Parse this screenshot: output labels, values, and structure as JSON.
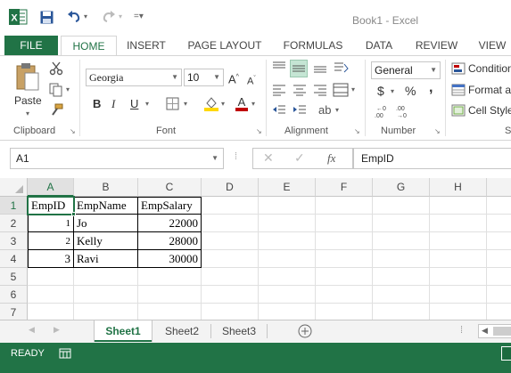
{
  "window": {
    "title": "Book1 - Excel"
  },
  "ribbon_tabs": [
    "FILE",
    "HOME",
    "INSERT",
    "PAGE LAYOUT",
    "FORMULAS",
    "DATA",
    "REVIEW",
    "VIEW"
  ],
  "ribbon": {
    "clipboard": {
      "paste_label": "Paste",
      "group_label": "Clipboard"
    },
    "font": {
      "name": "Georgia",
      "size": "10",
      "group_label": "Font",
      "bold": "B",
      "italic": "I",
      "underline": "U",
      "font_color": "#c00000",
      "fill_color": "#ffd800"
    },
    "alignment": {
      "group_label": "Alignment"
    },
    "number": {
      "format": "General",
      "currency": "$",
      "percent": "%",
      "comma": ",",
      "group_label": "Number"
    },
    "styles": {
      "conditional": "Condition",
      "format_as": "Format as",
      "cell_styles": "Cell Style",
      "group_label": "S"
    }
  },
  "formula_bar": {
    "name_box": "A1",
    "fx": "fx",
    "content": "EmpID"
  },
  "grid": {
    "columns": [
      "A",
      "B",
      "C",
      "D",
      "E",
      "F",
      "G",
      "H"
    ],
    "rows": [
      "1",
      "2",
      "3",
      "4",
      "5",
      "6",
      "7"
    ],
    "cells": {
      "A1": "EmpID",
      "B1": "EmpName",
      "C1": "EmpSalary",
      "A2": "1",
      "B2": "Jo",
      "C2": "22000",
      "A3": "2",
      "B3": "Kelly",
      "C3": "28000",
      "A4": "3",
      "B4": "Ravi",
      "C4": "30000"
    }
  },
  "sheets": [
    "Sheet1",
    "Sheet2",
    "Sheet3"
  ],
  "active_sheet": "Sheet1",
  "status": {
    "mode": "READY"
  },
  "colors": {
    "accent": "#217346"
  }
}
